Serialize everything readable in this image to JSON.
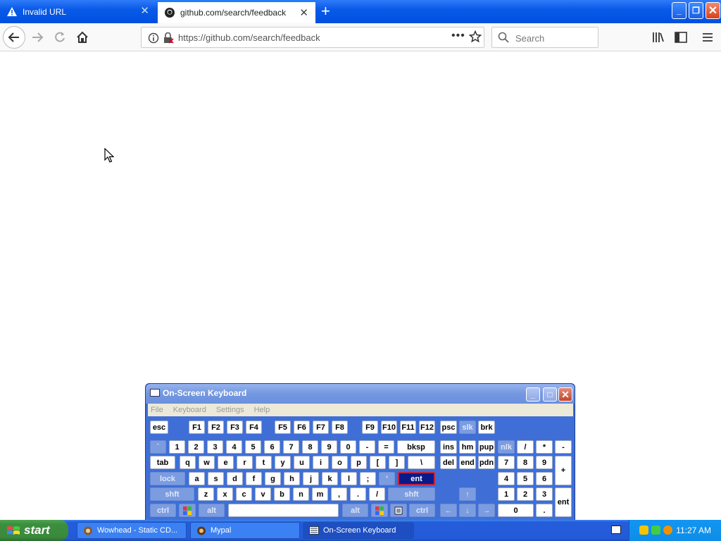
{
  "browser": {
    "tabs": [
      {
        "label": "Invalid URL",
        "icon": "warning-icon",
        "active": false
      },
      {
        "label": "github.com/search/feedback",
        "icon": "github-icon",
        "active": true
      }
    ],
    "url": "https://github.com/search/feedback",
    "search_placeholder": "Search"
  },
  "osk": {
    "title": "On-Screen Keyboard",
    "menu": [
      "File",
      "Keyboard",
      "Settings",
      "Help"
    ],
    "keys": {
      "esc": "esc",
      "f": [
        "F1",
        "F2",
        "F3",
        "F4",
        "F5",
        "F6",
        "F7",
        "F8",
        "F9",
        "F10",
        "F11",
        "F12"
      ],
      "psc": "psc",
      "slk": "slk",
      "brk": "brk",
      "row1": [
        "`",
        "1",
        "2",
        "3",
        "4",
        "5",
        "6",
        "7",
        "8",
        "9",
        "0",
        "-",
        "="
      ],
      "bksp": "bksp",
      "ins": "ins",
      "hm": "hm",
      "pup": "pup",
      "nlk": "nlk",
      "div": "/",
      "mul": "*",
      "sub": "-",
      "tab": "tab",
      "row2": [
        "q",
        "w",
        "e",
        "r",
        "t",
        "y",
        "u",
        "i",
        "o",
        "p",
        "[",
        "]",
        "\\"
      ],
      "del": "del",
      "end": "end",
      "pdn": "pdn",
      "n7": "7",
      "n8": "8",
      "n9": "9",
      "plus": "+",
      "lock": "lock",
      "row3": [
        "a",
        "s",
        "d",
        "f",
        "g",
        "h",
        "j",
        "k",
        "l",
        ";",
        "'"
      ],
      "ent": "ent",
      "n4": "4",
      "n5": "5",
      "n6": "6",
      "shft": "shft",
      "row4": [
        "z",
        "x",
        "c",
        "v",
        "b",
        "n",
        "m",
        ",",
        ".",
        "/"
      ],
      "n1": "1",
      "n2": "2",
      "n3": "3",
      "nent": "ent",
      "ctrl": "ctrl",
      "alt": "alt",
      "n0": "0",
      "ndot": "."
    }
  },
  "taskbar": {
    "start": "start",
    "items": [
      {
        "label": "Wowhead - Static CD...",
        "active": false
      },
      {
        "label": "Mypal",
        "active": false
      },
      {
        "label": "On-Screen Keyboard",
        "active": true
      }
    ],
    "clock": "11:27 AM"
  }
}
